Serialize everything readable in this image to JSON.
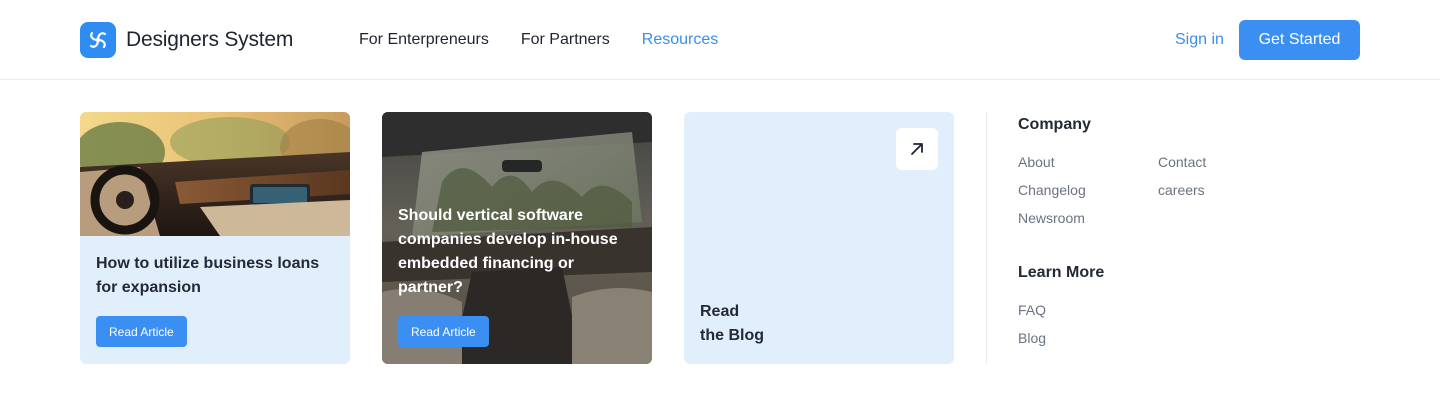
{
  "brand": {
    "name": "Designers System",
    "accent": "#3b8ff2",
    "logo_icon": "swirl-logo-icon"
  },
  "nav": [
    {
      "label": "For Enterpreneurs"
    },
    {
      "label": "For Partners"
    },
    {
      "label": "Resources",
      "active": true
    }
  ],
  "auth": {
    "sign_in": "Sign in",
    "get_started": "Get Started"
  },
  "cards": [
    {
      "title": "How to utilize business loans for expansion",
      "button": "Read Article",
      "image": "car-interior-dashboard-photo"
    },
    {
      "title": "Should vertical software companies develop in-house embedded financing or partner?",
      "button": "Read Article",
      "image": "car-interior-sunroof-photo"
    },
    {
      "title": "Read\nthe Blog",
      "icon": "arrow-up-right-icon"
    }
  ],
  "company": {
    "heading": "Company",
    "links_left": [
      "About",
      "Changelog",
      "Newsroom"
    ],
    "links_right": [
      "Contact",
      "careers"
    ]
  },
  "learn_more": {
    "heading": "Learn More",
    "links": [
      "FAQ",
      "Blog"
    ]
  }
}
